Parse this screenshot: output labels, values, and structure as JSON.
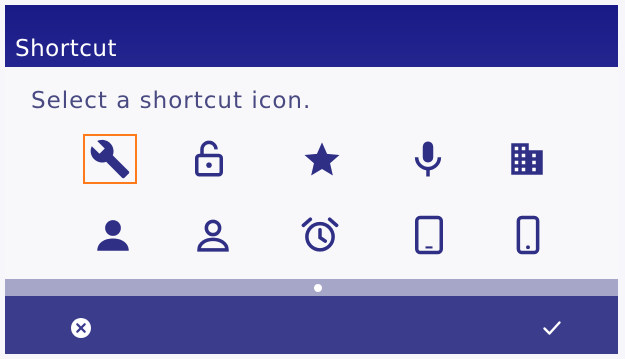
{
  "header": {
    "title": "Shortcut"
  },
  "content": {
    "prompt": "Select a shortcut icon."
  },
  "icons": [
    {
      "name": "wrench-icon",
      "selected": true
    },
    {
      "name": "unlock-icon",
      "selected": false
    },
    {
      "name": "star-icon",
      "selected": false
    },
    {
      "name": "microphone-icon",
      "selected": false
    },
    {
      "name": "building-icon",
      "selected": false
    },
    {
      "name": "person-filled-icon",
      "selected": false
    },
    {
      "name": "person-outline-icon",
      "selected": false
    },
    {
      "name": "alarm-clock-icon",
      "selected": false
    },
    {
      "name": "tablet-icon",
      "selected": false
    },
    {
      "name": "mobile-phone-icon",
      "selected": false
    }
  ],
  "pager": {
    "pages": 1,
    "current": 1
  },
  "footer": {
    "left_icon": "cancel-icon",
    "right_icon": "checkmark-icon"
  },
  "colors": {
    "header": "#1a1a86",
    "icon": "#2f2f86",
    "selection": "#ff7a1a",
    "footer": "#3c3c8c",
    "pager": "#a6a6c8"
  }
}
